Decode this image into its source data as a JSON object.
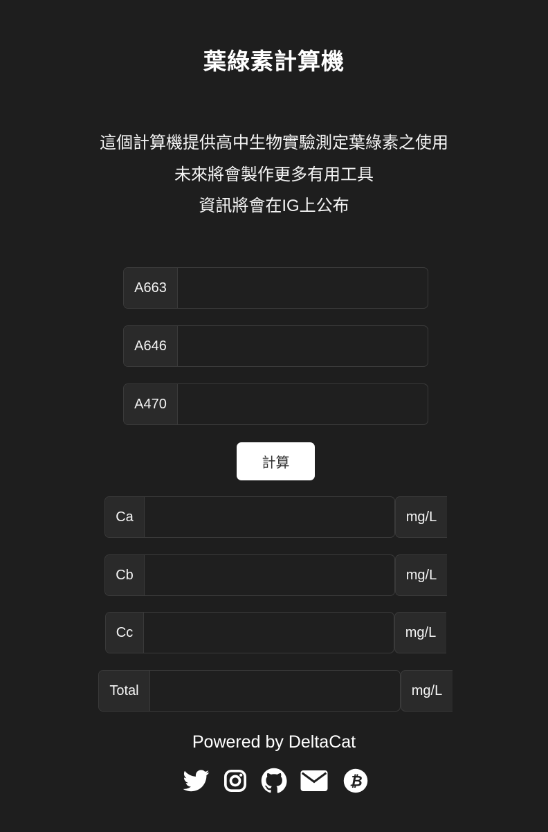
{
  "header": {
    "title": "葉綠素計算機"
  },
  "intro": {
    "line1": "這個計算機提供高中生物實驗測定葉綠素之使用",
    "line2": "未來將會製作更多有用工具",
    "line3": "資訊將會在IG上公布"
  },
  "inputs": {
    "a663": {
      "label": "A663",
      "value": ""
    },
    "a646": {
      "label": "A646",
      "value": ""
    },
    "a470": {
      "label": "A470",
      "value": ""
    }
  },
  "calculate_button": {
    "label": "計算"
  },
  "results": {
    "ca": {
      "label": "Ca",
      "value": "",
      "unit": "mg/L"
    },
    "cb": {
      "label": "Cb",
      "value": "",
      "unit": "mg/L"
    },
    "cc": {
      "label": "Cc",
      "value": "",
      "unit": "mg/L"
    },
    "total": {
      "label": "Total",
      "value": "",
      "unit": "mg/L"
    }
  },
  "footer": {
    "powered_by": "Powered by DeltaCat",
    "social_icons": [
      "twitter-icon",
      "instagram-icon",
      "github-icon",
      "email-icon",
      "bitcoin-icon"
    ]
  },
  "colors": {
    "background": "#1e1e1e",
    "text": "#ffffff",
    "label_bg": "#2a2a2a",
    "border": "#3a3a3a",
    "button_bg": "#ffffff"
  }
}
